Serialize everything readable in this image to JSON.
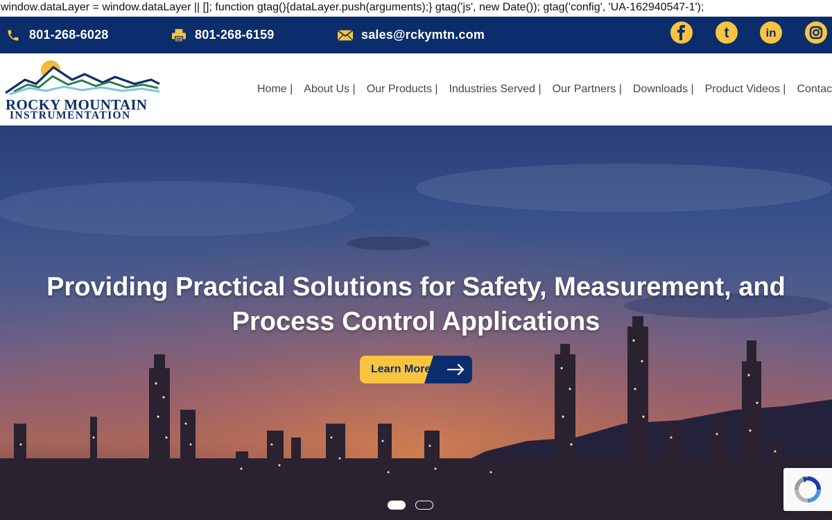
{
  "script_text": "window.dataLayer = window.dataLayer || []; function gtag(){dataLayer.push(arguments);} gtag('js', new Date()); gtag('config', 'UA-162940547-1');",
  "topbar": {
    "phone": "801-268-6028",
    "fax": "801-268-6159",
    "email": "sales@rckymtn.com",
    "social": [
      {
        "icon": "facebook-icon",
        "glyph": "f"
      },
      {
        "icon": "tumblr-icon",
        "glyph": "t"
      },
      {
        "icon": "linkedin-icon",
        "glyph": "in"
      },
      {
        "icon": "instagram-icon",
        "glyph": "◎"
      }
    ]
  },
  "logo": {
    "line1": "ROCKY MOUNTAIN",
    "line2": "INSTRUMENTATION"
  },
  "nav": {
    "items": [
      "Home |",
      "About Us |",
      "Our Products |",
      "Industries Served |",
      "Our Partners |",
      "Downloads |",
      "Product Videos |",
      "Contact"
    ]
  },
  "hero": {
    "title_line1": "Providing Practical Solutions for Safety, Measurement, and",
    "title_line2": "Process Control Applications",
    "cta_label": "Learn More",
    "slides": 2,
    "active_slide": 1
  },
  "colors": {
    "brand_navy": "#0b2d6b",
    "accent_yellow": "#f9c440"
  }
}
